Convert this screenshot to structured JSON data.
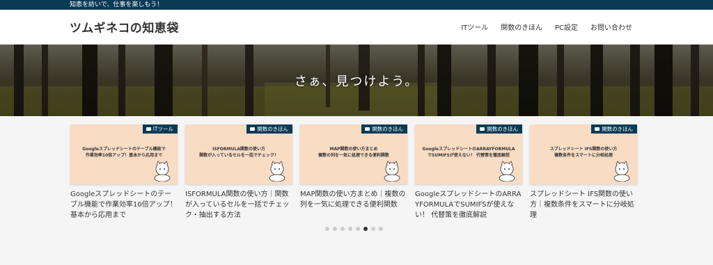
{
  "topbar": {
    "tagline": "知恵を紡いで、仕事を楽しもう！"
  },
  "header": {
    "site_title": "ツムギネコの知恵袋",
    "nav": [
      "ITツール",
      "関数のきほん",
      "PC設定",
      "お問い合わせ"
    ]
  },
  "hero": {
    "text": "さぁ、見つけよう。"
  },
  "cards": [
    {
      "category": "ITツール",
      "thumb_text": [
        "Googleスプレッドシートのテーブル機能で",
        "作業効率10倍アップ！基本から応用まで"
      ],
      "title": "Googleスプレッドシートのテーブル機能で作業効率10倍アップ！基本から応用まで"
    },
    {
      "category": "関数のきほん",
      "thumb_text": [
        "ISFORMULA関数の使い方",
        "関数が入っているセルを一括でチェック！"
      ],
      "title": "ISFORMULA関数の使い方｜関数が入っているセルを一括でチェック・抽出する方法"
    },
    {
      "category": "関数のきほん",
      "thumb_text": [
        "MAP関数の使い方まとめ",
        "複数の列を一気に処理できる便利関数"
      ],
      "title": "MAP関数の使い方まとめ｜複数の列を一気に処理できる便利関数"
    },
    {
      "category": "関数のきほん",
      "thumb_text": [
        "GoogleスプレッドシートのARRAYFORMULA",
        "でSUMIFSが使えない！ 代替策を徹底解説"
      ],
      "title": "GoogleスプレッドシートのARRAYFORMULAでSUMIFSが使えない！ 代替策を徹底解説"
    },
    {
      "category": "関数のきほん",
      "thumb_text": [
        "スプレッドシート IFS関数の使い方",
        "複数条件をスマートに分岐処理"
      ],
      "title": "スプレッドシート IFS関数の使い方｜複数条件をスマートに分岐処理"
    }
  ],
  "slider": {
    "dot_count": 8,
    "active_index": 5
  },
  "icons": {
    "category_badge": "folder-icon",
    "thumbnail_mascot": "cat-illustration"
  },
  "colors": {
    "brand_navy": "#0b3a55",
    "thumbnail_bg": "#f9dcc4",
    "page_bg": "#f5f5f5"
  }
}
